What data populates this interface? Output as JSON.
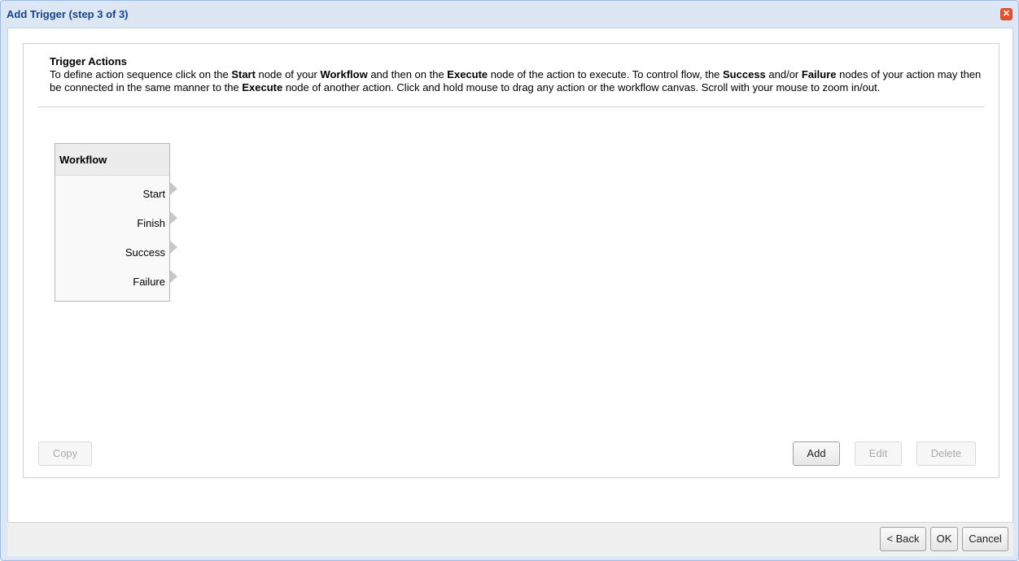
{
  "window": {
    "title": "Add Trigger (step 3 of 3)",
    "close_symbol": "✕"
  },
  "panel": {
    "heading": "Trigger Actions",
    "description": {
      "t1": "To define action sequence click on the ",
      "b1": "Start",
      "t2": " node of your ",
      "b2": "Workflow",
      "t3": " and then on the ",
      "b3": "Execute",
      "t4": " node of the action to execute. To control flow, the ",
      "b4": "Success",
      "t5": " and/or ",
      "b5": "Failure",
      "t6": " nodes of your action may then be connected in the same manner to the ",
      "b6": "Execute",
      "t7": " node of another action. Click and hold mouse to drag any action or the workflow canvas. Scroll with your mouse to zoom in/out."
    }
  },
  "workflow_node": {
    "title": "Workflow",
    "ports": [
      "Start",
      "Finish",
      "Success",
      "Failure"
    ]
  },
  "panel_buttons": {
    "copy": "Copy",
    "add": "Add",
    "edit": "Edit",
    "delete": "Delete"
  },
  "footer_buttons": {
    "back": "< Back",
    "ok": "OK",
    "cancel": "Cancel"
  },
  "icons": {
    "close": "close-icon",
    "port": "triangle-right-icon"
  },
  "colors": {
    "title_text": "#15428b",
    "window_frame": "#dde7f3",
    "close_button": "#e9502e"
  }
}
